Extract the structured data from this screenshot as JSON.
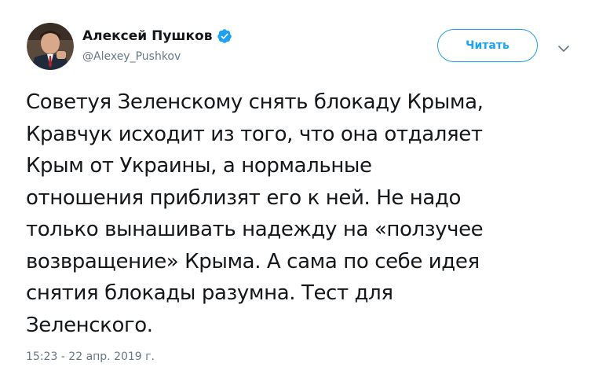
{
  "author": {
    "display_name": "Алексей Пушков",
    "handle": "@Alexey_Pushkov",
    "verified": true,
    "avatar_icon": "profile-photo"
  },
  "actions": {
    "follow_label": "Читать",
    "more_icon": "chevron-down-icon"
  },
  "tweet": {
    "lines": [
      "Советуя Зеленскому снять блокаду Крыма,",
      "Кравчук исходит из того, что она отдаляет",
      "Крым от Украины, а нормальные",
      "отношения приблизят его к ней. Не надо",
      "только вынашивать надежду на «ползучее",
      "возвращение» Крыма. А сама по себе идея",
      "снятия блокады разумна. Тест для",
      "Зеленского."
    ],
    "timestamp": "15:23 - 22 апр. 2019 г."
  },
  "colors": {
    "accent": "#1da1f2",
    "text": "#14171a",
    "muted": "#657786"
  }
}
